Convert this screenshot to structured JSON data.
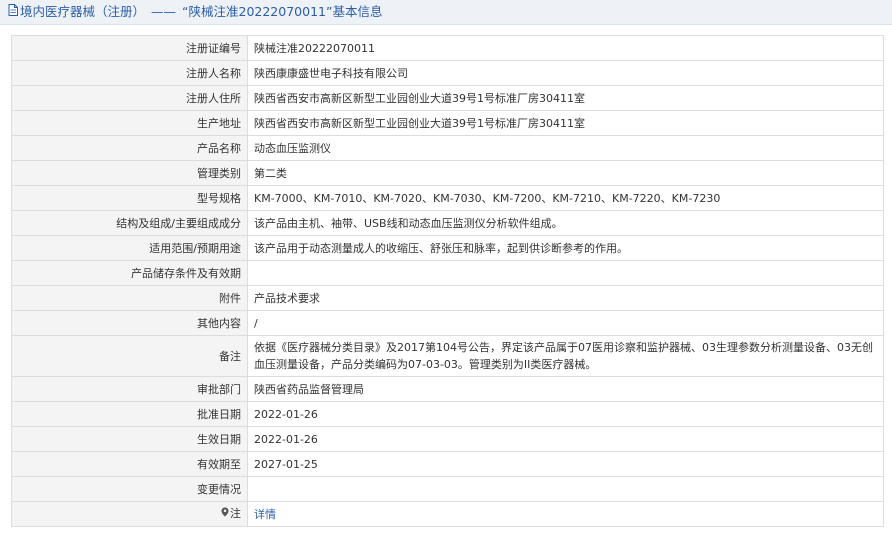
{
  "header": {
    "prefix": "境内医疗器械（注册）",
    "separator": "——",
    "subject": "“陕械注准20222070011”基本信息"
  },
  "rows": [
    {
      "label": "注册证编号",
      "value": "陕械注准20222070011"
    },
    {
      "label": "注册人名称",
      "value": "陕西康康盛世电子科技有限公司"
    },
    {
      "label": "注册人住所",
      "value": "陕西省西安市高新区新型工业园创业大道39号1号标准厂房30411室"
    },
    {
      "label": "生产地址",
      "value": "陕西省西安市高新区新型工业园创业大道39号1号标准厂房30411室"
    },
    {
      "label": "产品名称",
      "value": "动态血压监测仪"
    },
    {
      "label": "管理类别",
      "value": "第二类"
    },
    {
      "label": "型号规格",
      "value": "KM-7000、KM-7010、KM-7020、KM-7030、KM-7200、KM-7210、KM-7220、KM-7230"
    },
    {
      "label": "结构及组成/主要组成成分",
      "value": "该产品由主机、袖带、USB线和动态血压监测仪分析软件组成。"
    },
    {
      "label": "适用范围/预期用途",
      "value": "该产品用于动态测量成人的收缩压、舒张压和脉率，起到供诊断参考的作用。"
    },
    {
      "label": "产品储存条件及有效期",
      "value": ""
    },
    {
      "label": "附件",
      "value": "产品技术要求"
    },
    {
      "label": "其他内容",
      "value": "/"
    },
    {
      "label": "备注",
      "value": "依据《医疗器械分类目录》及2017第104号公告，界定该产品属于07医用诊察和监护器械、03生理参数分析测量设备、03无创血压测量设备，产品分类编码为07-03-03。管理类别为II类医疗器械。"
    },
    {
      "label": "审批部门",
      "value": "陕西省药品监督管理局"
    },
    {
      "label": "批准日期",
      "value": "2022-01-26"
    },
    {
      "label": "生效日期",
      "value": "2022-01-26"
    },
    {
      "label": "有效期至",
      "value": "2027-01-25"
    },
    {
      "label": "变更情况",
      "value": ""
    }
  ],
  "note": {
    "label": "注",
    "link": "详情"
  },
  "colors": {
    "header_bg": "#eef2f7",
    "title_text": "#2b5ea8",
    "label_bg": "#f4f4f4",
    "border": "#dcdcdc",
    "link": "#2b5ea8"
  }
}
